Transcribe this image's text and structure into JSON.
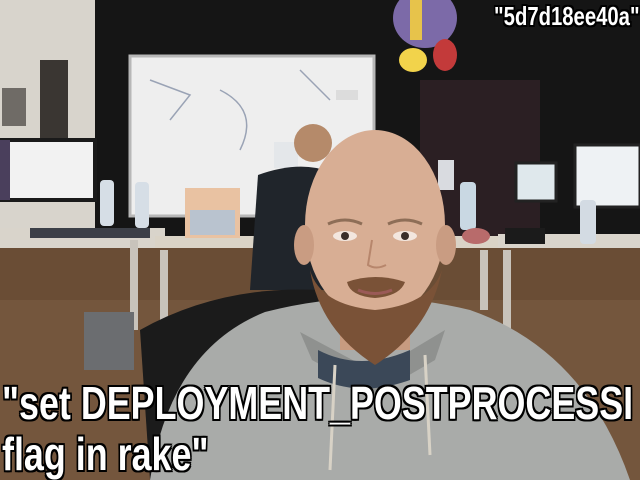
{
  "commit_hash_text": "\"5d7d18ee40a\"",
  "commit_message_line1": "\"set DEPLOYMENT_POSTPROCESSI",
  "commit_message_line2": "flag in rake\""
}
